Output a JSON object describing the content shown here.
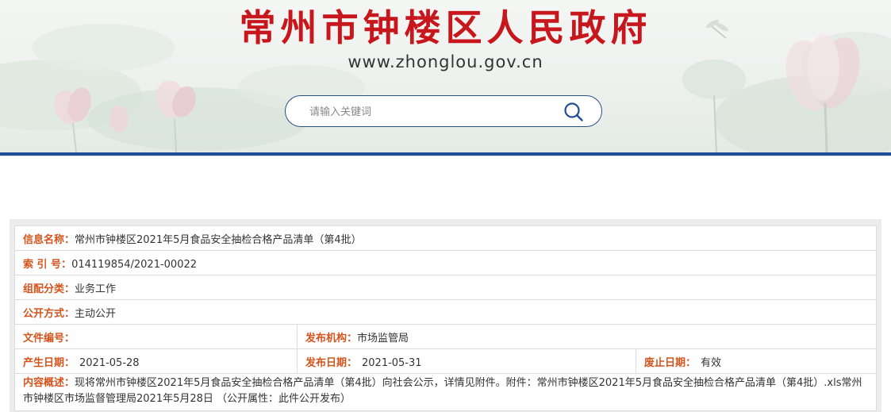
{
  "header": {
    "site_title": "常州市钟楼区人民政府",
    "site_url": "www.zhonglou.gov.cn",
    "title_color": "#c8161d",
    "accent_color": "#1e4f96"
  },
  "search": {
    "placeholder": "请输入关键词",
    "value": ""
  },
  "info": {
    "name": {
      "label": "信息名称：",
      "value": "常州市钟楼区2021年5月食品安全抽检合格产品清单（第4批）"
    },
    "index_no": {
      "label": "索 引 号：",
      "value": "014119854/2021-00022"
    },
    "category": {
      "label": "组配分类：",
      "value": "业务工作"
    },
    "disclosure": {
      "label": "公开方式：",
      "value": "主动公开"
    },
    "doc_no": {
      "label": "文件编号：",
      "value": ""
    },
    "publisher": {
      "label": "发布机构：",
      "value": "市场监管局"
    },
    "created": {
      "label": "产生日期：",
      "value": "2021-05-28"
    },
    "published": {
      "label": "发布日期：",
      "value": "2021-05-31"
    },
    "expiry": {
      "label": "废止日期：",
      "value": "有效"
    },
    "summary": {
      "label": "内容概述：",
      "value": "现将常州市钟楼区2021年5月食品安全抽检合格产品清单（第4批）向社会公示，详情见附件。附件：常州市钟楼区2021年5月食品安全抽检合格产品清单（第4批）.xls常州市钟楼区市场监督管理局2021年5月28日 （公开属性：此件公开发布）"
    }
  }
}
